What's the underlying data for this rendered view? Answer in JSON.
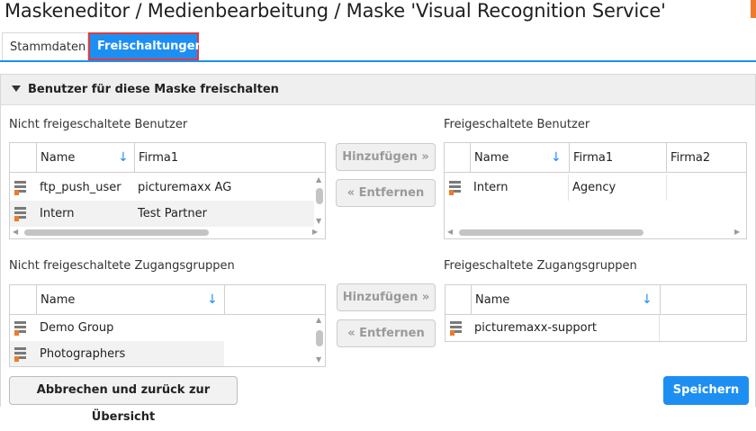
{
  "header": {
    "title": "Maskeneditor / Medienbearbeitung / Maske 'Visual Recognition Service'"
  },
  "tabs": [
    {
      "label": "Stammdaten"
    },
    {
      "label": "Freischaltungen",
      "active": true
    }
  ],
  "panel": {
    "title": "Benutzer für diese Maske freischalten"
  },
  "users": {
    "left_label": "Nicht freigeschaltete Benutzer",
    "right_label": "Freigeschaltete Benutzer",
    "left_columns": [
      "Name",
      "Firma1"
    ],
    "right_columns": [
      "Name",
      "Firma1",
      "Firma2"
    ],
    "left_rows": [
      {
        "name": "ftp_push_user",
        "firma1": "picturemaxx AG"
      },
      {
        "name": "Intern",
        "firma1": "Test Partner"
      }
    ],
    "right_rows": [
      {
        "name": "Intern",
        "firma1": "Agency",
        "firma2": ""
      }
    ],
    "add_label": "Hinzufügen »",
    "remove_label": "« Entfernen"
  },
  "groups": {
    "left_label": "Nicht freigeschaltete Zugangsgruppen",
    "right_label": "Freigeschaltete Zugangsgruppen",
    "column": "Name",
    "left_rows": [
      {
        "name": "Demo Group"
      },
      {
        "name": "Photographers"
      }
    ],
    "right_rows": [
      {
        "name": "picturemaxx-support"
      }
    ],
    "add_label": "Hinzufügen »",
    "remove_label": "« Entfernen"
  },
  "footer": {
    "cancel_label": "Abbrechen und zurück zur Übersicht",
    "save_label": "Speichern"
  },
  "colors": {
    "accent": "#1d8ff2",
    "highlight_border": "#e23b3b",
    "row_icon_flag": "#f07a2a"
  }
}
